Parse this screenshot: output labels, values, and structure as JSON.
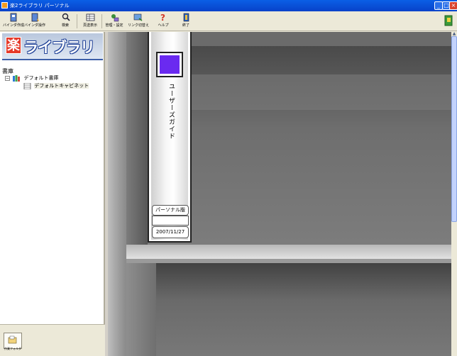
{
  "window": {
    "title": "楽2ライブラリ パーソナル",
    "minimize": "_",
    "maximize": "□",
    "close": "×"
  },
  "toolbar": {
    "items": [
      {
        "label": "バインダ作成",
        "icon": "binder-create-icon"
      },
      {
        "label": "バインダ操作",
        "icon": "binder-operate-icon"
      },
      {
        "label": "検索",
        "icon": "search-icon"
      },
      {
        "label": "頁送表示",
        "icon": "page-view-icon"
      },
      {
        "label": "管理・設定",
        "icon": "settings-icon"
      },
      {
        "label": "リンク切替え",
        "icon": "link-switch-icon"
      },
      {
        "label": "ヘルプ",
        "icon": "help-icon"
      },
      {
        "label": "終了",
        "icon": "exit-icon"
      }
    ]
  },
  "sidebar": {
    "logo_kanji": "楽",
    "logo_text": "ライブラリ",
    "library_header": "書庫",
    "tree": [
      {
        "label": "デフォルト書庫",
        "expander": "−"
      },
      {
        "label": "デフォルトキャビネット"
      }
    ],
    "folder_button_label": "作業フォルダ"
  },
  "binder": {
    "title": "ユーザーズガイド",
    "edition": "パーソナル版",
    "date": "2007/11/27",
    "color": "#6a2af0"
  },
  "scrollbar": {
    "up_arrow": "▲"
  }
}
